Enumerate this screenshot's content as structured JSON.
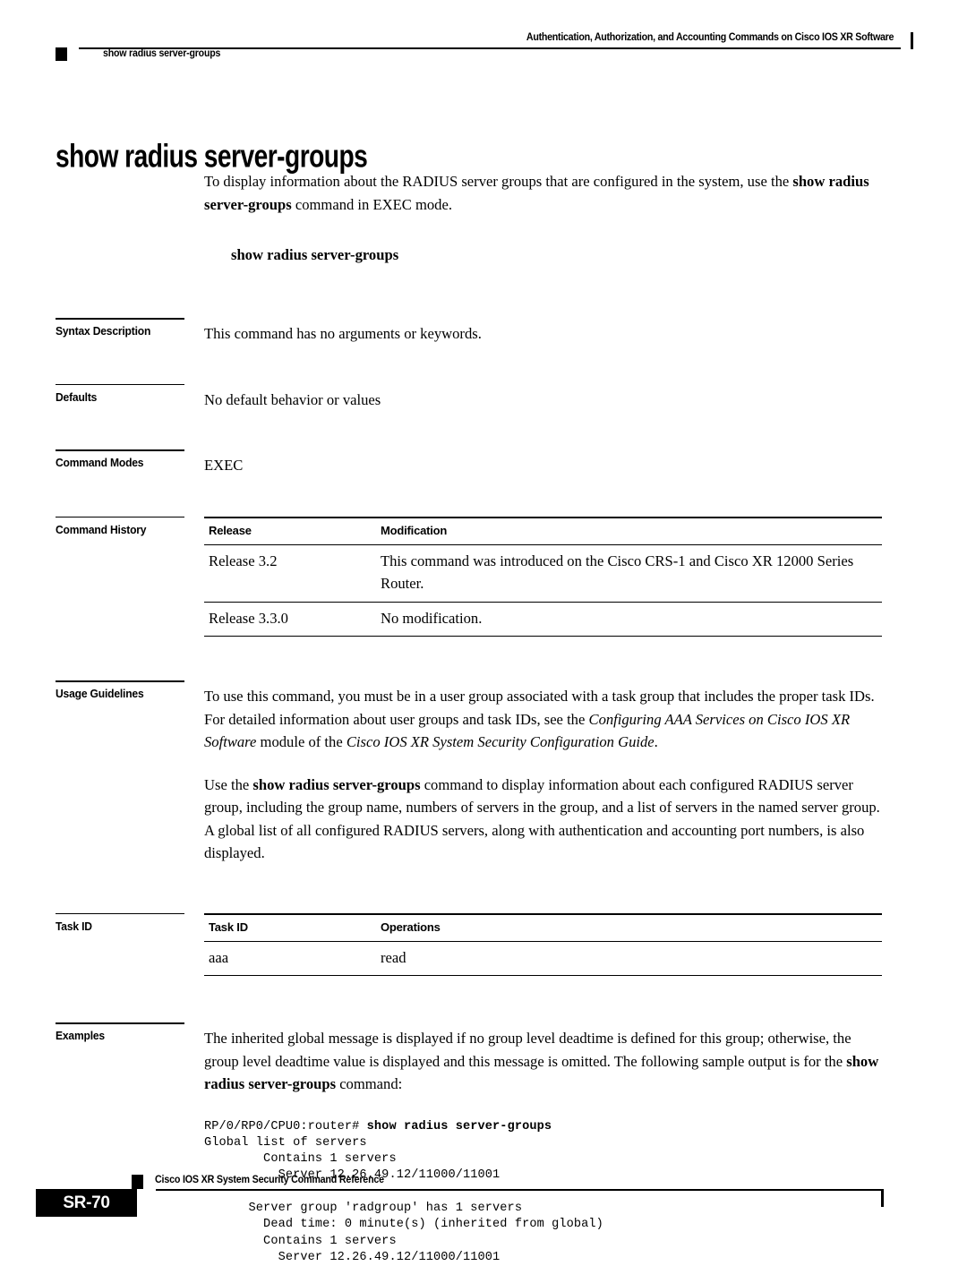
{
  "header": {
    "chapter_title": "Authentication, Authorization, and Accounting Commands on Cisco IOS XR Software",
    "command_name": "show radius server-groups"
  },
  "page_title": "show radius server-groups",
  "intro": {
    "text_1": "To display information about the RADIUS server groups that are configured in the system, use the ",
    "bold_1": "show radius server-groups",
    "text_2": " command in EXEC mode.",
    "syntax_line": "show radius server-groups"
  },
  "sections": {
    "syntax_description": {
      "label": "Syntax Description",
      "body": "This command has no arguments or keywords."
    },
    "defaults": {
      "label": "Defaults",
      "body": "No default behavior or values"
    },
    "command_modes": {
      "label": "Command Modes",
      "body": "EXEC"
    },
    "command_history": {
      "label": "Command History",
      "columns": [
        "Release",
        "Modification"
      ],
      "rows": [
        {
          "release": "Release 3.2",
          "modification": "This command was introduced on the Cisco CRS-1 and Cisco XR 12000 Series Router."
        },
        {
          "release": "Release 3.3.0",
          "modification": "No modification."
        }
      ]
    },
    "usage_guidelines": {
      "label": "Usage Guidelines",
      "para1_a": "To use this command, you must be in a user group associated with a task group that includes the proper task IDs. For detailed information about user groups and task IDs, see the ",
      "para1_italic_1": "Configuring AAA Services on Cisco IOS XR Software",
      "para1_b": " module of the ",
      "para1_italic_2": "Cisco IOS XR System Security Configuration Guide",
      "para1_c": ".",
      "para2_a": "Use the ",
      "para2_bold": "show radius server-groups",
      "para2_b": " command to display information about each configured RADIUS server group, including the group name, numbers of servers in the group, and a list of servers in the named server group. A global list of all configured RADIUS servers, along with authentication and accounting port numbers, is also displayed."
    },
    "task_id": {
      "label": "Task ID",
      "columns": [
        "Task ID",
        "Operations"
      ],
      "rows": [
        {
          "task_id": "aaa",
          "operations": "read"
        }
      ]
    },
    "examples": {
      "label": "Examples",
      "para_a": "The inherited global message is displayed if no group level deadtime is defined for this group; otherwise, the group level deadtime value is displayed and this message is omitted. The following sample output is for the ",
      "para_bold": "show radius server-groups",
      "para_b": " command:",
      "console_prompt": "RP/0/RP0/CPU0:router# ",
      "console_command": "show radius server-groups",
      "console_output": "\nGlobal list of servers\n        Contains 1 servers\n          Server 12.26.49.12/11000/11001\n\n      Server group 'radgroup' has 1 servers\n        Dead time: 0 minute(s) (inherited from global)\n        Contains 1 servers\n          Server 12.26.49.12/11000/11001"
    }
  },
  "footer": {
    "document_title": "Cisco IOS XR System Security Command Reference",
    "page_number": "SR-70"
  }
}
